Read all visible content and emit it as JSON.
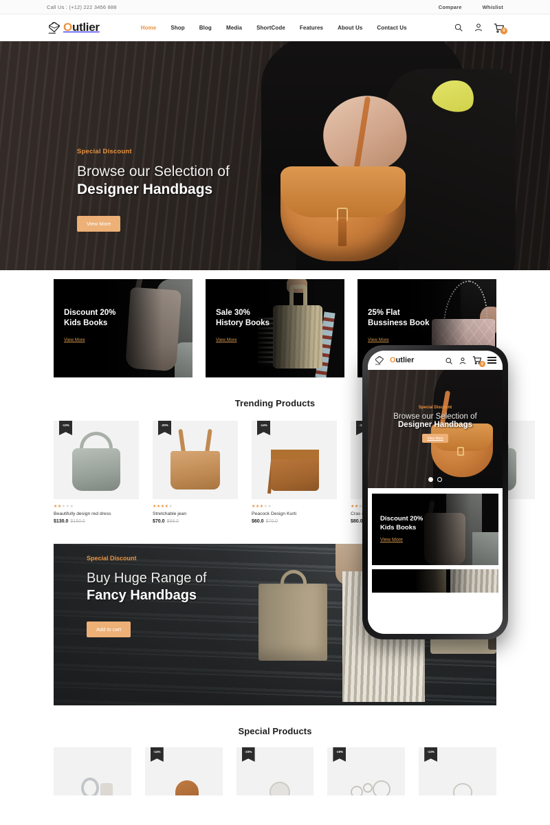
{
  "topbar": {
    "call_us": "Call Us : (+12) 222 3456 888",
    "compare": "Compare",
    "wishlist": "Whislist"
  },
  "header": {
    "logo_o": "O",
    "logo_rest": "utlier",
    "nav": [
      {
        "label": "Home",
        "active": true
      },
      {
        "label": "Shop",
        "active": false
      },
      {
        "label": "Blog",
        "active": false
      },
      {
        "label": "Media",
        "active": false
      },
      {
        "label": "ShortCode",
        "active": false
      },
      {
        "label": "Features",
        "active": false
      },
      {
        "label": "About Us",
        "active": false
      },
      {
        "label": "Contact Us",
        "active": false
      }
    ],
    "cart_count": "0"
  },
  "hero": {
    "eyebrow": "Special Discount",
    "line1": "Browse our Selection of",
    "line2": "Designer Handbags",
    "cta": "View More"
  },
  "promos": [
    {
      "line1": "Discount 20%",
      "line2": "Kids Books",
      "link": "View More"
    },
    {
      "line1": "Sale 30%",
      "line2": "History Books",
      "link": "View More"
    },
    {
      "line1": "25% Flat",
      "line2": "Bussiness Book",
      "link": "View More"
    }
  ],
  "trending": {
    "title": "Trending Products",
    "products": [
      {
        "badge": "-13%",
        "stars": 2,
        "name": "Beautifully design red dress",
        "price": "$130.0",
        "old_price": "$150.0"
      },
      {
        "badge": "-20%",
        "stars": 4,
        "name": "Stretchable jean",
        "price": "$70.0",
        "old_price": "$88.0"
      },
      {
        "badge": "-14%",
        "stars": 3,
        "name": "Peacock Design Kurti",
        "price": "$60.0",
        "old_price": "$70.0"
      },
      {
        "badge": "-11%",
        "stars": 2,
        "name": "Cras eget Alessi d",
        "price": "$80.0",
        "old_price": ""
      }
    ]
  },
  "banner": {
    "eyebrow": "Special Discount",
    "line1": "Buy Huge Range of",
    "line2": "Fancy Handbags",
    "cta": "Add to cart"
  },
  "phone": {
    "logo_o": "O",
    "logo_rest": "utlier",
    "cart_count": "0",
    "hero_eyebrow": "Special Discount",
    "hero_line1": "Browse our Selection of",
    "hero_line2": "Designer Handbags",
    "hero_cta": "View More",
    "promo_line1": "Discount 20%",
    "promo_line2": "Kids Books",
    "promo_link": "View More"
  },
  "special": {
    "title": "Special Products",
    "cards": [
      {
        "badge": ""
      },
      {
        "badge": "-14%"
      },
      {
        "badge": "-23%"
      },
      {
        "badge": "-19%"
      },
      {
        "badge": "-13%"
      }
    ]
  },
  "icons": {
    "search": "search-icon",
    "user": "user-icon",
    "cart": "cart-icon",
    "menu": "hamburger-menu-icon"
  },
  "colors": {
    "accent": "#e8923f",
    "button": "#edb077",
    "dark": "#1c1c1c"
  }
}
